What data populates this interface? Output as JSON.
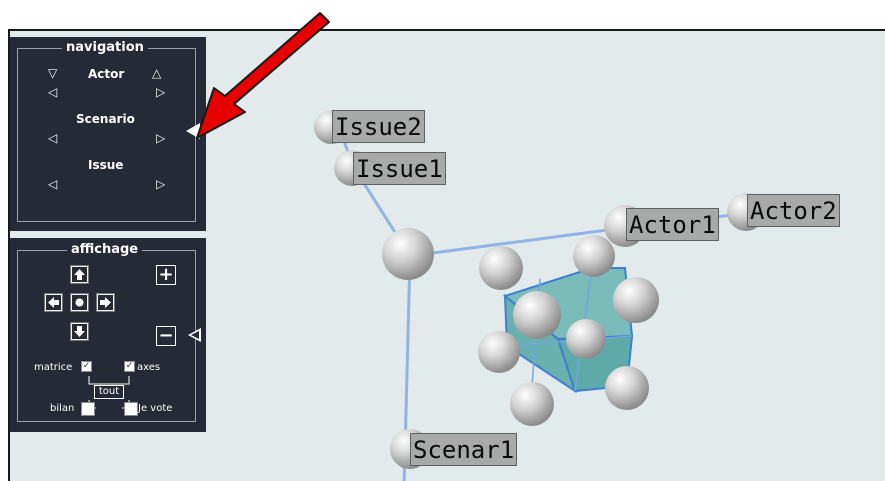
{
  "navigation": {
    "title": "navigation",
    "actor_label": "Actor",
    "scenario_label": "Scenario",
    "issue_label": "Issue"
  },
  "affichage": {
    "title": "affichage",
    "zoom_in": "+",
    "zoom_out": "−",
    "matrice_label": "matrice",
    "axes_label": "axes",
    "tout_label": "tout",
    "bilan_label": "bilan",
    "vote_label": "Je vote",
    "matrice_checked": true,
    "axes_checked": true
  },
  "nodes": {
    "issue2": "Issue2",
    "issue1": "Issue1",
    "actor1": "Actor1",
    "actor2": "Actor2",
    "scenar1": "Scenar1"
  },
  "colors": {
    "panel_bg": "#262a36",
    "canvas_bg": "#e3eaec",
    "cube_fill": "#4fa3a0",
    "axis_line": "#8fb4e6",
    "arrow": "#e60000"
  },
  "icons": [
    "arrow-up-icon",
    "arrow-down-icon",
    "arrow-left-icon",
    "arrow-right-icon",
    "center-dot-icon",
    "triangle-left-icon",
    "triangle-right-icon",
    "triangle-up-icon",
    "triangle-down-icon",
    "check-icon"
  ]
}
